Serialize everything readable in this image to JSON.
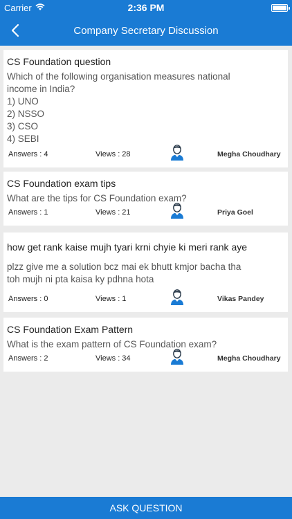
{
  "status_bar": {
    "carrier": "Carrier",
    "time": "2:36 PM"
  },
  "nav": {
    "title": "Company Secretary Discussion"
  },
  "questions": [
    {
      "title": "CS Foundation question",
      "body": "Which of the following organisation measures national\nincome in India?\n1) UNO\n2) NSSO\n3) CSO\n4) SEBI",
      "answers": "Answers : 4",
      "views": "Views : 28",
      "user": "Megha Choudhary"
    },
    {
      "title": "CS Foundation exam tips",
      "body": "What are the tips for CS Foundation exam?",
      "answers": "Answers : 1",
      "views": "Views : 21",
      "user": "Priya Goel"
    },
    {
      "title": "how get rank kaise mujh tyari krni chyie ki meri rank aye",
      "body": "plzz give me a solution bcz mai ek bhutt kmjor bacha tha\ntoh mujh ni pta kaisa ky pdhna hota",
      "answers": "Answers : 0",
      "views": "Views : 1",
      "user": "Vikas Pandey"
    },
    {
      "title": "CS Foundation Exam Pattern",
      "body": "What is the exam pattern of CS Foundation exam?",
      "answers": "Answers : 2",
      "views": "Views : 34",
      "user": "Megha Choudhary"
    }
  ],
  "ask_button": {
    "label": "ASK QUESTION"
  },
  "colors": {
    "accent": "#1a7bd4",
    "avatar_dark": "#2a3a4a",
    "avatar_accent": "#1a7bd4"
  },
  "icons": {
    "back": "chevron-left-icon",
    "user": "user-avatar-icon",
    "wifi": "wifi-icon",
    "battery": "battery-icon"
  }
}
